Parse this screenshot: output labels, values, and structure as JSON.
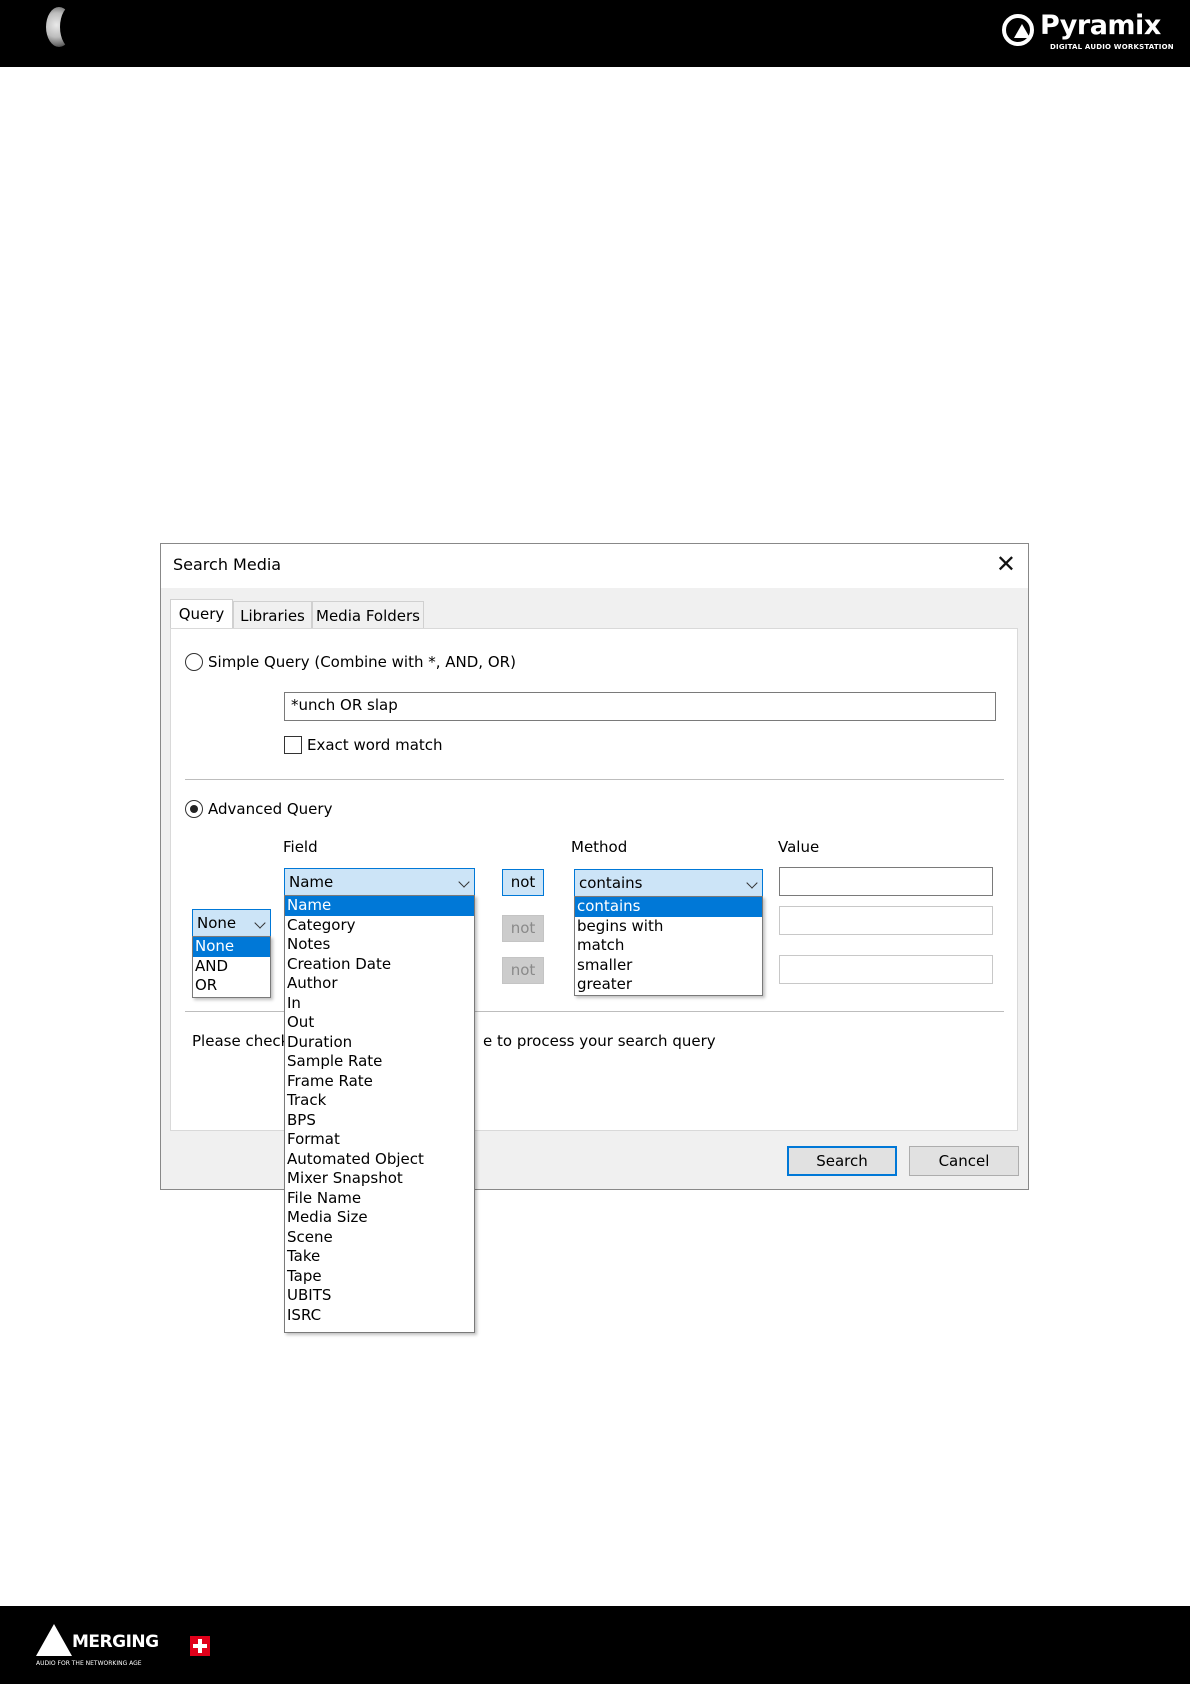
{
  "header": {
    "brand_name": "Pyramix",
    "brand_tagline": "DIGITAL AUDIO WORKSTATION"
  },
  "footer": {
    "brand_name": "MERGING",
    "brand_tagline": "AUDIO FOR THE NETWORKING AGE"
  },
  "dialog": {
    "title": "Search Media",
    "close_glyph": "✕",
    "tabs": [
      "Query",
      "Libraries",
      "Media Folders"
    ],
    "simple_query": {
      "label": "Simple Query  (Combine with *, AND, OR)",
      "value": "*unch OR slap",
      "exact_word_match": "Exact word match"
    },
    "advanced_query": {
      "label": "Advanced Query",
      "headers": {
        "field": "Field",
        "method": "Method",
        "value": "Value"
      },
      "field_selected": "Name",
      "not_label": "not",
      "method_selected": "contains",
      "combine_selected": "None",
      "combine_options": [
        "None",
        "AND",
        "OR"
      ],
      "field_options": [
        "Name",
        "Category",
        "Notes",
        "Creation Date",
        "Author",
        "In",
        "Out",
        "Duration",
        "Sample Rate",
        "Frame Rate",
        "Track",
        "BPS",
        "Format",
        "Automated Object",
        "Mixer Snapshot",
        "File Name",
        "Media Size",
        "Scene",
        "Take",
        "Tape",
        "UBITS",
        "ISRC"
      ],
      "method_options": [
        "contains",
        "begins with",
        "match",
        "smaller",
        "greater"
      ]
    },
    "status_left": "Please check",
    "status_right": "e to process your search query",
    "buttons": {
      "search": "Search",
      "cancel": "Cancel"
    }
  }
}
